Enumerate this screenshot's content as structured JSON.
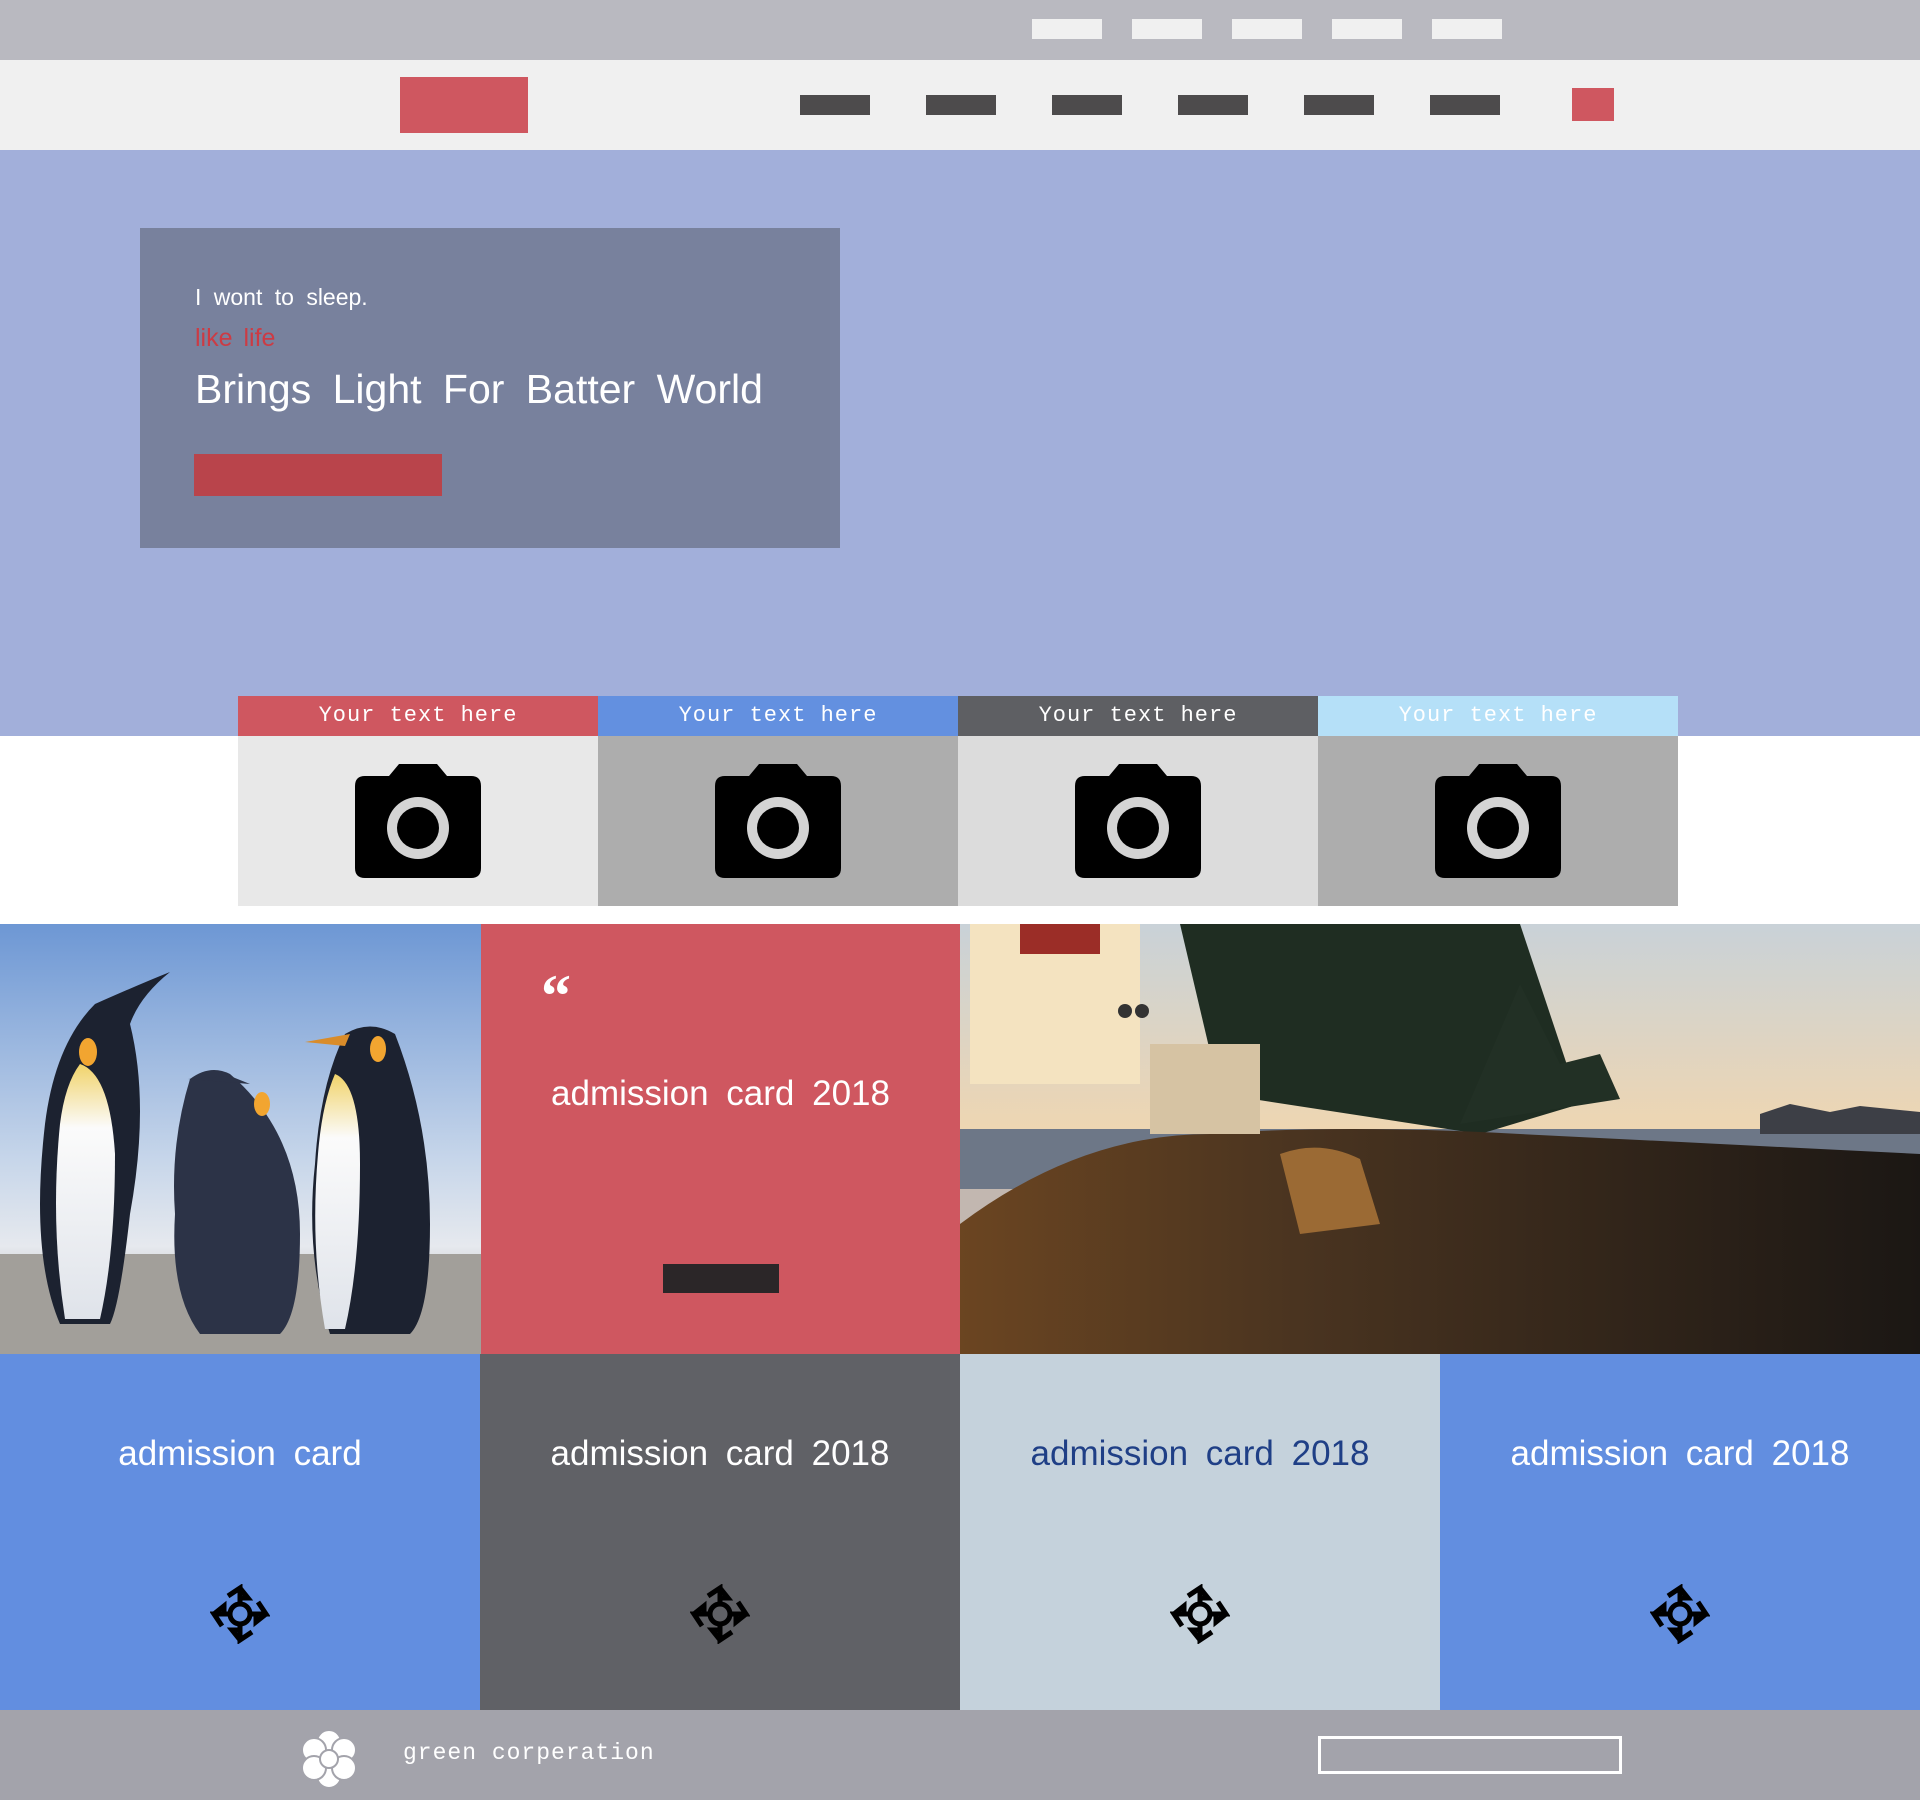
{
  "hero": {
    "subtitle": "I wont to sleep.",
    "tagline": "like life",
    "title": "Brings Light For Batter World"
  },
  "tiles": [
    {
      "label": "Your text here",
      "icon": "camera-icon",
      "head_color": "#cf5760",
      "body_color": "#e8e8e8"
    },
    {
      "label": "Your text here",
      "icon": "camera-icon",
      "head_color": "#6390e0",
      "body_color": "#adadad"
    },
    {
      "label": "Your text here",
      "icon": "camera-icon",
      "head_color": "#5e5f63",
      "body_color": "#dcdcdc"
    },
    {
      "label": "Your text here",
      "icon": "camera-icon",
      "head_color": "#b5e0f8",
      "body_color": "#adadad"
    }
  ],
  "quote_card": {
    "mark": "“",
    "text": "admission card 2018"
  },
  "cards": [
    {
      "title": "admission card",
      "icon": "target-icon",
      "bg": "#628ee0",
      "color": "#ffffff"
    },
    {
      "title": "admission card 2018",
      "icon": "target-icon",
      "bg": "#606166",
      "color": "#ffffff"
    },
    {
      "title": "admission card 2018",
      "icon": "target-icon",
      "bg": "#c5d2dc",
      "color": "#1f3f86"
    },
    {
      "title": "admission card 2018",
      "icon": "target-icon",
      "bg": "#628ee0",
      "color": "#ffffff"
    }
  ],
  "footer": {
    "company": "green corperation",
    "logo_icon": "flower-icon"
  }
}
